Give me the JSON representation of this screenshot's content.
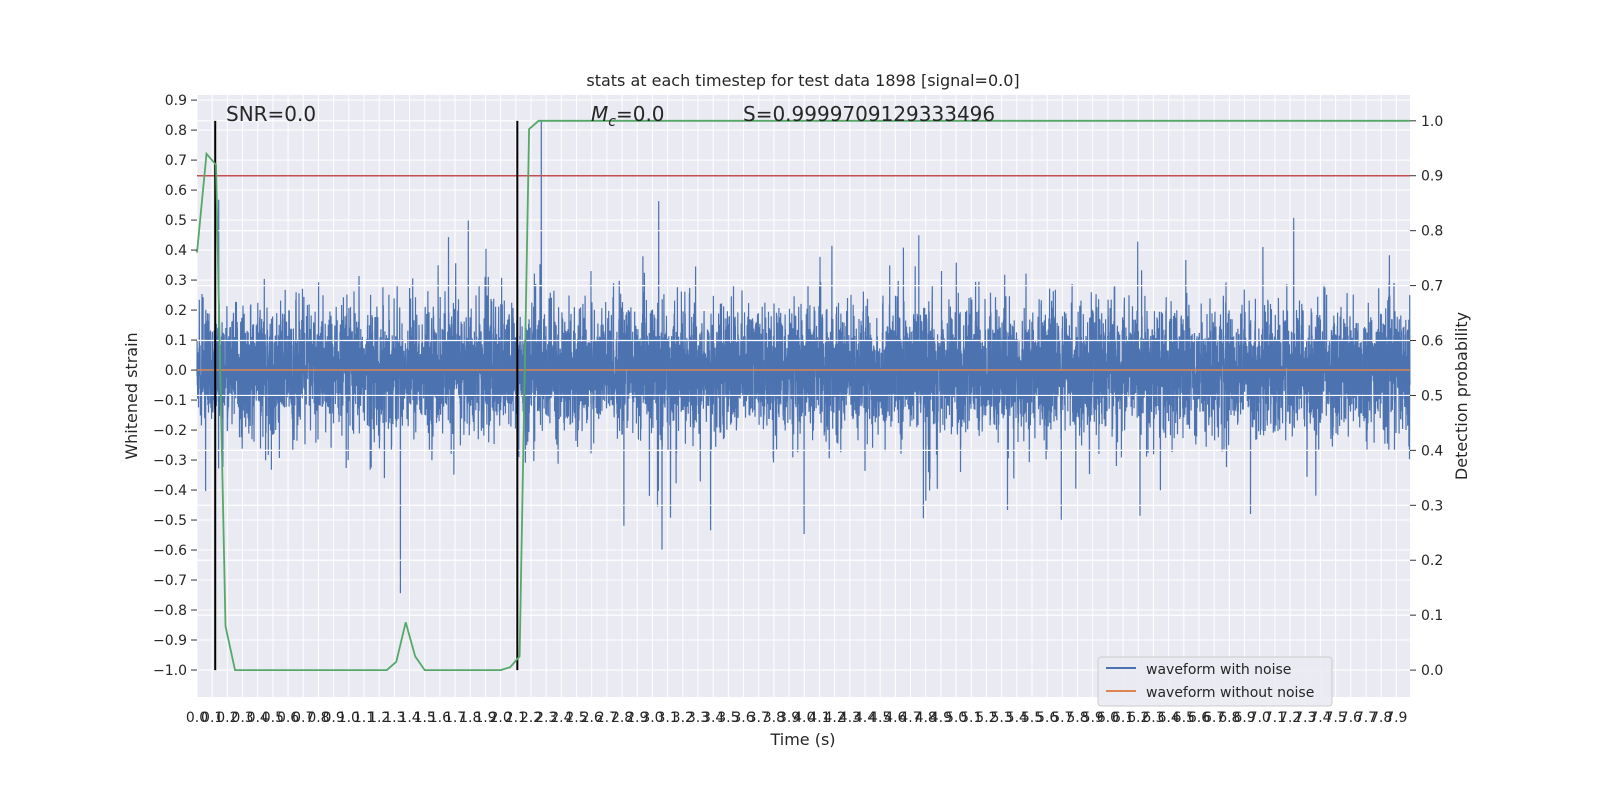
{
  "chart_data": {
    "type": "line",
    "title": "stats at each timestep for test data 1898 [signal=0.0]",
    "xlabel": "Time (s)",
    "ylabel": "Whitened strain",
    "ylabel_right": "Detection probability",
    "xlim": [
      0.0,
      7.99
    ],
    "ylim": [
      -1.09,
      0.917
    ],
    "ylim_right": [
      -0.049,
      1.047
    ],
    "xticks": [
      "0.0",
      "0.1",
      "0.2",
      "0.3",
      "0.4",
      "0.5",
      "0.6",
      "0.7",
      "0.8",
      "0.9",
      "1.0",
      "1.1",
      "1.2",
      "1.3",
      "1.4",
      "1.5",
      "1.6",
      "1.7",
      "1.8",
      "1.9",
      "2.0",
      "2.1",
      "2.2",
      "2.3",
      "2.4",
      "2.5",
      "2.6",
      "2.7",
      "2.8",
      "2.9",
      "3.0",
      "3.1",
      "3.2",
      "3.3",
      "3.4",
      "3.5",
      "3.6",
      "3.7",
      "3.8",
      "3.9",
      "4.0",
      "4.1",
      "4.2",
      "4.3",
      "4.4",
      "4.5",
      "4.6",
      "4.7",
      "4.8",
      "4.9",
      "5.0",
      "5.1",
      "5.2",
      "5.3",
      "5.4",
      "5.5",
      "5.6",
      "5.7",
      "5.8",
      "5.9",
      "6.0",
      "6.1",
      "6.2",
      "6.3",
      "6.4",
      "6.5",
      "6.6",
      "6.7",
      "6.8",
      "6.9",
      "7.0",
      "7.1",
      "7.2",
      "7.3",
      "7.4",
      "7.5",
      "7.6",
      "7.7",
      "7.8",
      "7.9"
    ],
    "yticks": [
      "0.9",
      "0.8",
      "0.7",
      "0.6",
      "0.5",
      "0.4",
      "0.3",
      "0.2",
      "0.1",
      "0.0",
      "−0.1",
      "−0.2",
      "−0.3",
      "−0.4",
      "−0.5",
      "−0.6",
      "−0.7",
      "−0.8",
      "−0.9",
      "−1.0"
    ],
    "yticks_right": [
      "1.0",
      "0.9",
      "0.8",
      "0.7",
      "0.6",
      "0.5",
      "0.4",
      "0.3",
      "0.2",
      "0.1",
      "0.0"
    ],
    "grid": true,
    "legend_placement": "lower-right",
    "series": [
      {
        "name": "waveform with noise",
        "axis": "left",
        "color": "#4c72b0",
        "kind": "gaussian noise",
        "mean": 0.0,
        "std": 0.1,
        "min": -1.0,
        "max": 0.83
      },
      {
        "name": "waveform without noise",
        "axis": "left",
        "color": "#dd8452",
        "x": [
          0.0,
          7.99
        ],
        "y": [
          0.0,
          0.0
        ]
      },
      {
        "axis": "right",
        "color": "#55a868",
        "x": [
          0.0,
          0.0625,
          0.125,
          0.1875,
          0.25,
          0.3125,
          1.1875,
          1.25,
          1.3125,
          1.375,
          1.4375,
          1.5,
          2.0,
          2.0625,
          2.125,
          2.1875,
          2.25,
          7.99
        ],
        "y": [
          0.76,
          0.94,
          0.92,
          0.08,
          0.0,
          0.0,
          0.0,
          0.0,
          0.015,
          0.087,
          0.025,
          0.0,
          0.0,
          0.005,
          0.025,
          0.985,
          1.0,
          1.0
        ]
      },
      {
        "axis": "right",
        "color": "#c44e52",
        "kind": "threshold",
        "y": 0.9
      }
    ],
    "vlines": [
      {
        "x": 0.12,
        "ymin": 0.0,
        "ymax": 1.0,
        "color": "#000000"
      },
      {
        "x": 2.11,
        "ymin": 0.0,
        "ymax": 1.0,
        "color": "#000000"
      }
    ],
    "annotations": {
      "snr": "SNR=0.0",
      "mc_symbol": "M",
      "mc_sub": "c",
      "mc_value": "=0.0",
      "s": "S=0.9999709129333496"
    }
  }
}
